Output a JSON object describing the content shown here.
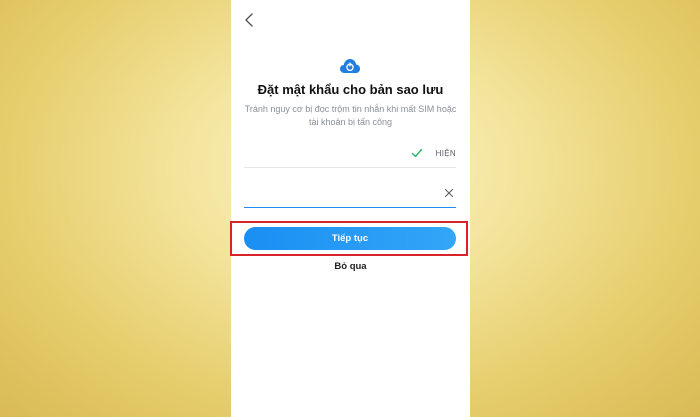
{
  "screen": {
    "title": "Đặt mật khẩu cho bản sao lưu",
    "subtitle": "Tránh nguy cơ bị đọc trộm tin nhắn khi mất SIM hoặc tài khoản bị tấn công"
  },
  "password_field": {
    "value": "",
    "show_label": "HIỆN",
    "status_icon": "check-icon"
  },
  "confirm_field": {
    "value": "",
    "clear_icon": "close-icon"
  },
  "actions": {
    "continue_label": "Tiếp tục",
    "skip_label": "Bỏ qua"
  },
  "icons": {
    "back": "chevron-left-icon",
    "header": "cloud-backup-icon"
  },
  "colors": {
    "accent": "#1f8cf0",
    "highlight_border": "#d8232a",
    "check": "#2db36a",
    "background": "#f3e49b"
  }
}
